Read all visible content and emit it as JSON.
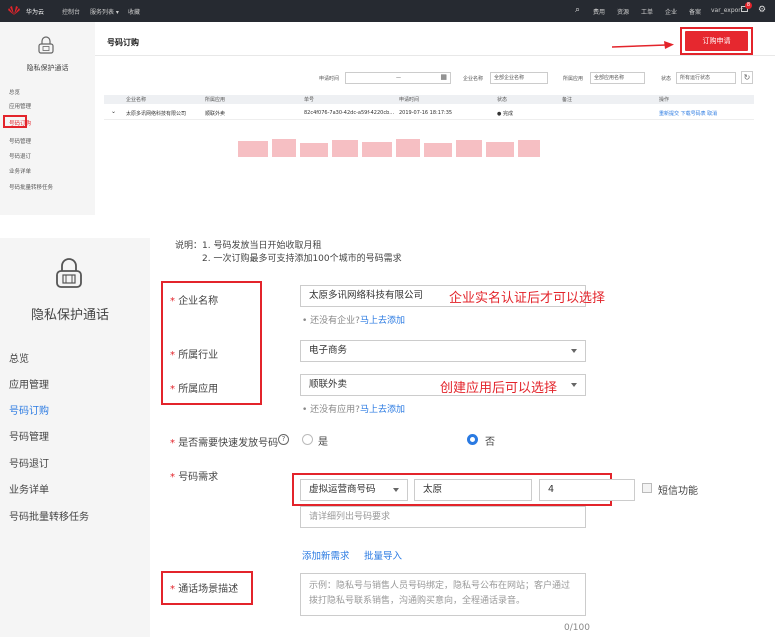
{
  "topbar": {
    "brand": "华为云",
    "console": "控制台",
    "services": "服务列表 ▾",
    "favorites": "收藏",
    "right_items": [
      "费用",
      "资源",
      "工单",
      "企业",
      "备案",
      "var_export"
    ],
    "badge_count": "8"
  },
  "sidebar_small": {
    "title": "隐私保护通话",
    "items": [
      "总览",
      "应用管理",
      "号码订购",
      "号码管理",
      "号码退订",
      "业务详单",
      "号码批量转移任务"
    ],
    "active_index": 2
  },
  "order_page": {
    "title": "号码订购",
    "order_button": "订购申请",
    "filters": {
      "apply_time_label": "申请时间",
      "apply_time_sep": "—",
      "company_label": "企业名称",
      "company_value": "全部企业名称",
      "app_label": "所属应用",
      "app_value": "全部应用名称",
      "status_label": "状态",
      "status_value": "所有运行状态"
    },
    "table": {
      "headers": [
        "企业名称",
        "所属应用",
        "单号",
        "申请时间",
        "状态",
        "备注",
        "操作"
      ],
      "rows": [
        {
          "company": "太原多讯网络科技有限公司",
          "app": "顺联外卖",
          "order_no": "82c4f076-7a30-42dc-a59f-4220cb...",
          "time": "2019-07-16 18:17:35",
          "status": "● 完成",
          "remark": "",
          "actions": "重新提交 下载号码表 取消"
        }
      ]
    }
  },
  "sidebar_large": {
    "title": "隐私保护通话",
    "items": [
      "总览",
      "应用管理",
      "号码订购",
      "号码管理",
      "号码退订",
      "业务详单",
      "号码批量转移任务"
    ],
    "active_index": 2
  },
  "form": {
    "note_prefix": "说明：",
    "notes": [
      "1. 号码发放当日开始收取月租",
      "2. 一次订购最多可支持添加100个城市的号码需求"
    ],
    "required_mark": "*",
    "company": {
      "label": "企业名称",
      "value": "太原多讯网络科技有限公司",
      "hint": "• 还没有企业?",
      "hint_link": "马上去添加"
    },
    "industry": {
      "label": "所属行业",
      "value": "电子商务"
    },
    "app": {
      "label": "所属应用",
      "value": "顺联外卖",
      "hint": "• 还没有应用?",
      "hint_link": "马上去添加"
    },
    "fast": {
      "label": "是否需要快速发放号码",
      "help": "?",
      "option_yes": "是",
      "option_no": "否",
      "selected": "否"
    },
    "demand": {
      "label": "号码需求",
      "type_value": "虚拟运营商号码",
      "city_value": "太原",
      "count_value": "4",
      "sms_label": "短信功能",
      "placeholder": "请详细列出号码要求"
    },
    "add_demand": "添加新需求",
    "bulk_import": "批量导入",
    "scenario": {
      "label": "通话场景描述",
      "placeholder": "示例：隐私号与销售人员号码绑定，隐私号公布在网站；客户通过拨打隐私号联系销售，沟通购买意向，全程通话录音。",
      "counter": "0/100"
    }
  },
  "annotations": {
    "company_note": "企业实名认证后才可以选择",
    "app_note": "创建应用后可以选择"
  },
  "colors": {
    "accent": "#e3242b",
    "link": "#2a7ae2",
    "topbar": "#262a31",
    "selected_radio": "#2a7ae2"
  }
}
